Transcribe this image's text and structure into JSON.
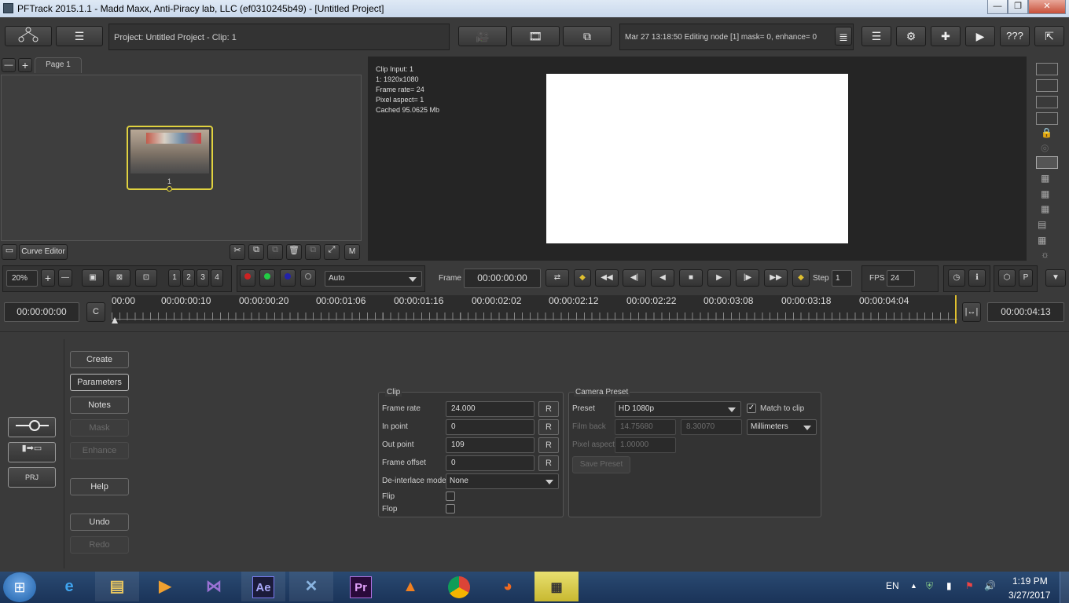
{
  "window": {
    "title": "PFTrack 2015.1.1 - Madd Maxx, Anti-Piracy lab, LLC (ef0310245b49) - [Untitled Project]",
    "minimize": "—",
    "maximize": "❐",
    "close": "✕"
  },
  "toolbar": {
    "project_info": "Project: Untitled Project - Clip: 1",
    "status": "Mar 27 13:18:50 Editing node [1] mask= 0, enhance= 0",
    "help_label": "???"
  },
  "tree": {
    "page_tab": "Page 1",
    "node_label": "1",
    "curve_editor": "Curve Editor"
  },
  "viewer": {
    "info": [
      "Clip Input: 1",
      "1: 1920x1080",
      "Frame rate= 24",
      "Pixel aspect= 1",
      "Cached 95.0625 Mb"
    ]
  },
  "transport": {
    "zoom": "20%",
    "view_nums": [
      "1",
      "2",
      "3",
      "4"
    ],
    "channel_mode": "Auto",
    "frame_label": "Frame",
    "frame_value": "00:00:00:00",
    "step_label": "Step",
    "step_value": "1",
    "fps_label": "FPS",
    "fps_value": "24",
    "p_label": "P"
  },
  "timeline": {
    "start": "00:00:00:00",
    "c_label": "C",
    "end": "00:00:04:13",
    "ticks": [
      "00:00",
      "00:00:00:10",
      "00:00:00:20",
      "00:00:01:06",
      "00:00:01:16",
      "00:00:02:02",
      "00:00:02:12",
      "00:00:02:22",
      "00:00:03:08",
      "00:00:03:18",
      "00:00:04:04"
    ]
  },
  "sidebar": {
    "buttons": [
      "Create",
      "Parameters",
      "Notes",
      "Mask",
      "Enhance",
      "Help",
      "Undo",
      "Redo"
    ],
    "prj_label": "PRJ"
  },
  "clip": {
    "group_title": "Clip",
    "frame_rate_label": "Frame rate",
    "frame_rate": "24.000",
    "in_point_label": "In point",
    "in_point": "0",
    "out_point_label": "Out point",
    "out_point": "109",
    "frame_offset_label": "Frame offset",
    "frame_offset": "0",
    "deinterlace_label": "De-interlace mode",
    "deinterlace": "None",
    "flip_label": "Flip",
    "flop_label": "Flop",
    "reset_label": "R"
  },
  "camera": {
    "group_title": "Camera Preset",
    "preset_label": "Preset",
    "preset": "HD 1080p",
    "match_label": "Match to clip",
    "film_back_label": "Film back",
    "film_back_w": "14.75680",
    "film_back_h": "8.30070",
    "units": "Millimeters",
    "pixel_aspect_label": "Pixel aspect",
    "pixel_aspect": "1.00000",
    "save_preset": "Save Preset"
  },
  "taskbar": {
    "lang": "EN",
    "time": "1:19 PM",
    "date": "3/27/2017"
  }
}
